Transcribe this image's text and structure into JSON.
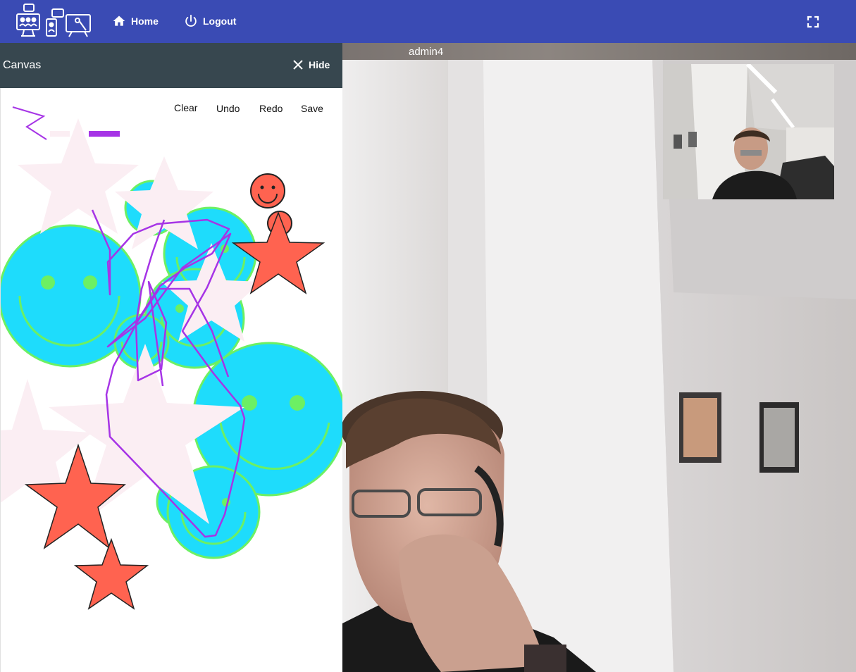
{
  "appbar": {
    "home_label": "Home",
    "logout_label": "Logout",
    "background": "#3a4bb4"
  },
  "canvas": {
    "title": "Canvas",
    "hide_label": "Hide",
    "toolbar": {
      "clear_label": "Clear",
      "undo_label": "Undo",
      "redo_label": "Redo",
      "save_label": "Save"
    },
    "colors": {
      "header": "#37474f",
      "smiley_fill": "#1edcfc",
      "smiley_stroke": "#6cf063",
      "star_red": "#ff6350",
      "star_pink": "#fbeef3",
      "pen": "#a634e6"
    }
  },
  "video": {
    "participant_name": "admin4"
  },
  "icons": {
    "logo": "classroom-logo-icon",
    "home": "home-icon",
    "logout": "power-icon",
    "fullscreen": "fullscreen-icon",
    "close": "close-icon"
  }
}
